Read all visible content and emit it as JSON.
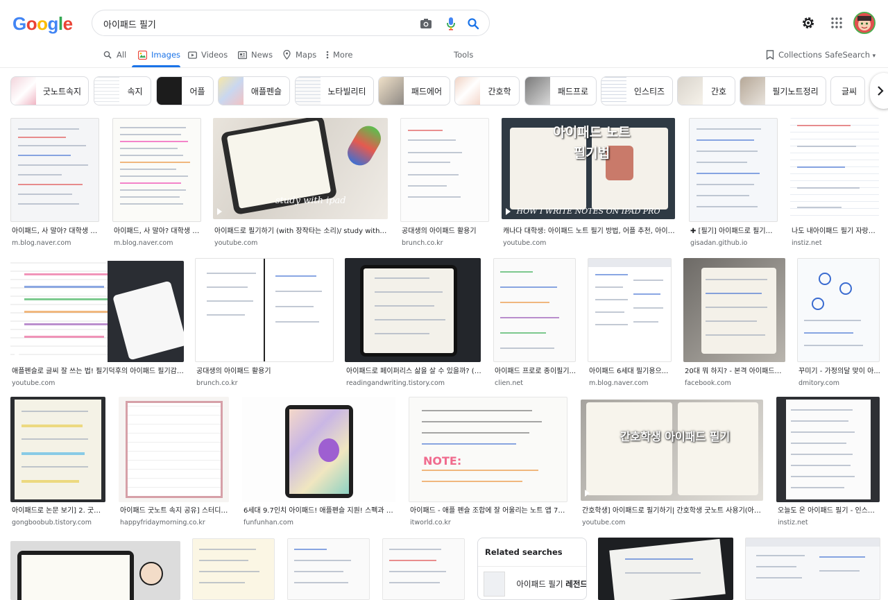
{
  "search": {
    "query": "아이패드 필기"
  },
  "logo": [
    "G",
    "o",
    "o",
    "g",
    "l",
    "e"
  ],
  "logo_colors": [
    "#4285f4",
    "#ea4335",
    "#fbbc05",
    "#4285f4",
    "#34a853",
    "#ea4335"
  ],
  "tabs": [
    {
      "label": "All",
      "icon": "search-icon",
      "active": false
    },
    {
      "label": "Images",
      "icon": "image-icon",
      "active": true
    },
    {
      "label": "Videos",
      "icon": "video-icon",
      "active": false
    },
    {
      "label": "News",
      "icon": "news-icon",
      "active": false
    },
    {
      "label": "Maps",
      "icon": "map-pin-icon",
      "active": false
    },
    {
      "label": "More",
      "icon": "more-vert-icon",
      "active": false
    }
  ],
  "toolbar": {
    "tools": "Tools",
    "collections": "Collections",
    "safesearch": "SafeSearch"
  },
  "chips": [
    "굿노트속지",
    "속지",
    "어플",
    "애플펜슬",
    "노타빌리티",
    "패드에어",
    "간호학",
    "패드프로",
    "인스티즈",
    "간호",
    "필기노트정리",
    "글씨"
  ],
  "results": [
    {
      "title": "아이패드, 사 말아? 대학생 아...",
      "source": "m.blog.naver.com"
    },
    {
      "title": "아이패드, 사 말아? 대학생 아...",
      "source": "m.blog.naver.com"
    },
    {
      "title": "아이패드로 필기하기 (with 장작타는 소리)/ study with me...",
      "source": "youtube.com"
    },
    {
      "title": "공대생의 아이패드 활용기",
      "source": "brunch.co.kr"
    },
    {
      "title": "캐나다 대학생: 아이패드 노트 필기 방법, 어플 추천, 아이패드...",
      "source": "youtube.com"
    },
    {
      "title": "✚ [필기] 아이패드로 필기는 ...",
      "source": "gisadan.github.io"
    },
    {
      "title": "나도 내아이패드 필기 자랑할...",
      "source": "instiz.net"
    },
    {
      "title": "애플펜슬로 글씨 잘 쓰는 법! 필기덕후의 아이패드 필기감 최...",
      "source": "youtube.com"
    },
    {
      "title": "공대생의 아이패드 활용기",
      "source": "brunch.co.kr"
    },
    {
      "title": "아이패드로 페이퍼리스 삶을 살 수 있을까? (아...",
      "source": "readingandwriting.tistory.com"
    },
    {
      "title": "아이패드 프로로 종이필기...",
      "source": "clien.net"
    },
    {
      "title": "아이패드 6세대 필기용으...",
      "source": "m.blog.naver.com"
    },
    {
      "title": "20대 뭐 하지? - 본격 아이패드로 ...",
      "source": "facebook.com"
    },
    {
      "title": "꾸미기 - 가정의달 맞이 아...",
      "source": "dmitory.com"
    },
    {
      "title": "아이패드로 논문 보기] 2. 굿노...",
      "source": "gongboobub.tistory.com"
    },
    {
      "title": "아이패드 굿노트 속지 공유] 스터디 ...",
      "source": "happyfridaymorning.co.kr"
    },
    {
      "title": "6세대 9.7인치 아이패드! 애플펜슬 지원! 스펙과 가격!",
      "source": "funfunhan.com"
    },
    {
      "title": "아이패드 - 애플 펜슬 조합에 잘 어울리는 노트 앱 7종 ...",
      "source": "itworld.co.kr"
    },
    {
      "title": "간호학생] 아이패드로 필기하기| 간호학생 굿노트 사용기(아이패...",
      "source": "youtube.com"
    },
    {
      "title": "오늘도 온 아이패드 필기 - 인스티...",
      "source": "instiz.net"
    }
  ],
  "thumb_overlays": {
    "r2": "study with ipad",
    "r4a": "아이패드 노트",
    "r4b": "필기법",
    "r4c": "HOW I WRITE NOTES ON IPAD PRO",
    "r18": "간호학생 아이패드 필기"
  },
  "related": {
    "title": "Related searches",
    "item_prefix": "아이패드 필기 ",
    "item_bold": "레전드"
  },
  "colors": {
    "accent": "#1a73e8",
    "text": "#202124",
    "muted": "#5f6368"
  }
}
